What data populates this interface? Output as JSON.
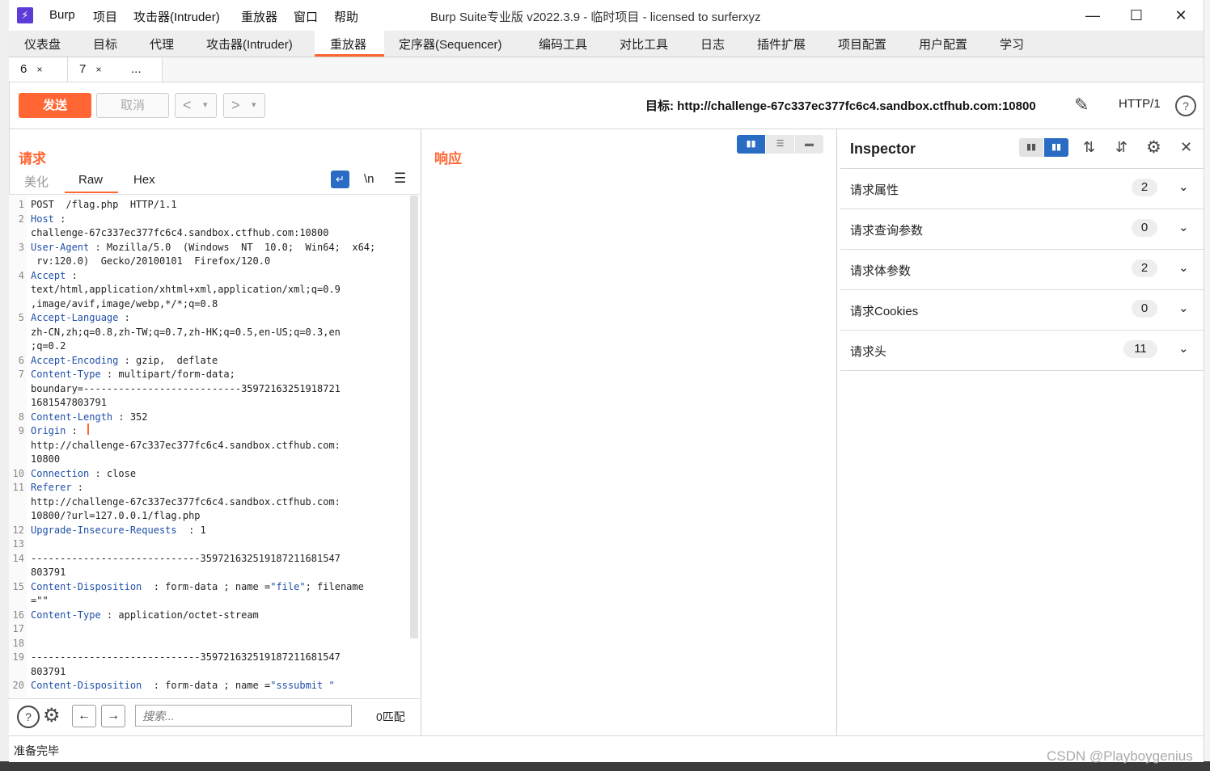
{
  "window": {
    "title": "Burp Suite专业版  v2022.3.9 - 临时项目 - licensed to surferxyz",
    "menu": [
      "Burp",
      "项目",
      "攻击器(Intruder)",
      "重放器",
      "窗口",
      "帮助"
    ],
    "logo_glyph": "⚡"
  },
  "main_tabs": [
    "仪表盘",
    "目标",
    "代理",
    "攻击器(Intruder)",
    "重放器",
    "定序器(Sequencer)",
    "编码工具",
    "对比工具",
    "日志",
    "插件扩展",
    "项目配置",
    "用户配置",
    "学习"
  ],
  "main_tab_active": "重放器",
  "sub_tabs": [
    {
      "label": "6",
      "close": "×"
    },
    {
      "label": "7",
      "close": "×"
    },
    {
      "label": "..."
    }
  ],
  "toolbar": {
    "send": "发送",
    "cancel": "取消",
    "back": "<",
    "forward": ">",
    "dropdown": "▾",
    "target": "目标: http://challenge-67c337ec377fc6c4.sandbox.ctfhub.com:10800",
    "http_version": "HTTP/1"
  },
  "request": {
    "title": "请求",
    "tabs": [
      "美化",
      "Raw",
      "Hex"
    ],
    "active_tab": "Raw",
    "newline_toggle": "\\n",
    "lines": [
      {
        "n": "1",
        "parts": [
          [
            "t",
            "POST  /flag.php  HTTP/1.1"
          ]
        ]
      },
      {
        "n": "2",
        "parts": [
          [
            "h",
            "Host"
          ],
          [
            "t",
            " :"
          ]
        ]
      },
      {
        "n": "",
        "parts": [
          [
            "t",
            "challenge-67c337ec377fc6c4.sandbox.ctfhub.com:10800"
          ]
        ]
      },
      {
        "n": "3",
        "parts": [
          [
            "h",
            "User-Agent"
          ],
          [
            "t",
            " : Mozilla/5.0  (Windows  NT  10.0;  Win64;  x64;"
          ]
        ]
      },
      {
        "n": "",
        "parts": [
          [
            "t",
            " rv:120.0)  Gecko/20100101  Firefox/120.0"
          ]
        ]
      },
      {
        "n": "4",
        "parts": [
          [
            "h",
            "Accept"
          ],
          [
            "t",
            " :"
          ]
        ]
      },
      {
        "n": "",
        "parts": [
          [
            "t",
            "text/html,application/xhtml+xml,application/xml;q=0.9"
          ]
        ]
      },
      {
        "n": "",
        "parts": [
          [
            "t",
            ",image/avif,image/webp,*/*;q=0.8"
          ]
        ]
      },
      {
        "n": "5",
        "parts": [
          [
            "h",
            "Accept-Language"
          ],
          [
            "t",
            " :"
          ]
        ]
      },
      {
        "n": "",
        "parts": [
          [
            "t",
            "zh-CN,zh;q=0.8,zh-TW;q=0.7,zh-HK;q=0.5,en-US;q=0.3,en"
          ]
        ]
      },
      {
        "n": "",
        "parts": [
          [
            "t",
            ";q=0.2"
          ]
        ]
      },
      {
        "n": "6",
        "parts": [
          [
            "h",
            "Accept-Encoding"
          ],
          [
            "t",
            " : gzip,  deflate"
          ]
        ]
      },
      {
        "n": "7",
        "parts": [
          [
            "h",
            "Content-Type"
          ],
          [
            "t",
            " : multipart/form-data;"
          ]
        ]
      },
      {
        "n": "",
        "parts": [
          [
            "t",
            "boundary=---------------------------35972163251918721"
          ]
        ]
      },
      {
        "n": "",
        "parts": [
          [
            "t",
            "1681547803791"
          ]
        ]
      },
      {
        "n": "8",
        "parts": [
          [
            "h",
            "Content-Length"
          ],
          [
            "t",
            " : 352"
          ]
        ]
      },
      {
        "n": "9",
        "parts": [
          [
            "h",
            "Origin"
          ],
          [
            "t",
            " :"
          ]
        ]
      },
      {
        "n": "",
        "parts": [
          [
            "t",
            "http://challenge-67c337ec377fc6c4.sandbox.ctfhub.com:"
          ]
        ]
      },
      {
        "n": "",
        "parts": [
          [
            "t",
            "10800"
          ]
        ]
      },
      {
        "n": "10",
        "parts": [
          [
            "h",
            "Connection"
          ],
          [
            "t",
            " : close"
          ]
        ]
      },
      {
        "n": "11",
        "parts": [
          [
            "h",
            "Referer"
          ],
          [
            "t",
            " :"
          ]
        ]
      },
      {
        "n": "",
        "parts": [
          [
            "t",
            "http://challenge-67c337ec377fc6c4.sandbox.ctfhub.com:"
          ]
        ]
      },
      {
        "n": "",
        "parts": [
          [
            "t",
            "10800/?url=127.0.0.1/flag.php"
          ]
        ]
      },
      {
        "n": "12",
        "parts": [
          [
            "h",
            "Upgrade-Insecure-Requests"
          ],
          [
            "t",
            "  : 1"
          ]
        ]
      },
      {
        "n": "13",
        "parts": [
          [
            "t",
            ""
          ]
        ]
      },
      {
        "n": "14",
        "parts": [
          [
            "t",
            "-----------------------------359721632519187211681547"
          ]
        ]
      },
      {
        "n": "",
        "parts": [
          [
            "t",
            "803791"
          ]
        ]
      },
      {
        "n": "15",
        "parts": [
          [
            "h",
            "Content-Disposition"
          ],
          [
            "t",
            "  : form-data ; name ="
          ],
          [
            "s",
            "\"file\""
          ],
          [
            "t",
            "; filename"
          ]
        ]
      },
      {
        "n": "",
        "parts": [
          [
            "t",
            "=\"\""
          ]
        ]
      },
      {
        "n": "16",
        "parts": [
          [
            "h",
            "Content-Type"
          ],
          [
            "t",
            " : application/octet-stream"
          ]
        ]
      },
      {
        "n": "17",
        "parts": [
          [
            "t",
            ""
          ]
        ]
      },
      {
        "n": "18",
        "parts": [
          [
            "t",
            ""
          ]
        ]
      },
      {
        "n": "19",
        "parts": [
          [
            "t",
            "-----------------------------359721632519187211681547"
          ]
        ]
      },
      {
        "n": "",
        "parts": [
          [
            "t",
            "803791"
          ]
        ]
      },
      {
        "n": "20",
        "parts": [
          [
            "h",
            "Content-Disposition"
          ],
          [
            "t",
            "  : form-data ; name ="
          ],
          [
            "s",
            "\"sssubmit \""
          ]
        ]
      }
    ],
    "search_placeholder": "搜索...",
    "matches": "0匹配"
  },
  "response": {
    "title": "响应"
  },
  "inspector": {
    "title": "Inspector",
    "sections": [
      {
        "label": "请求属性",
        "count": "2"
      },
      {
        "label": "请求查询参数",
        "count": "0"
      },
      {
        "label": "请求体参数",
        "count": "2"
      },
      {
        "label": "请求Cookies",
        "count": "0"
      },
      {
        "label": "请求头",
        "count": "11"
      }
    ]
  },
  "status": {
    "text": "准备完毕"
  },
  "watermark": "CSDN @Playboygenius",
  "colors": {
    "accent": "#ff6633",
    "header_key": "#1e4fa8",
    "toggle_active": "#2a6cc4"
  }
}
